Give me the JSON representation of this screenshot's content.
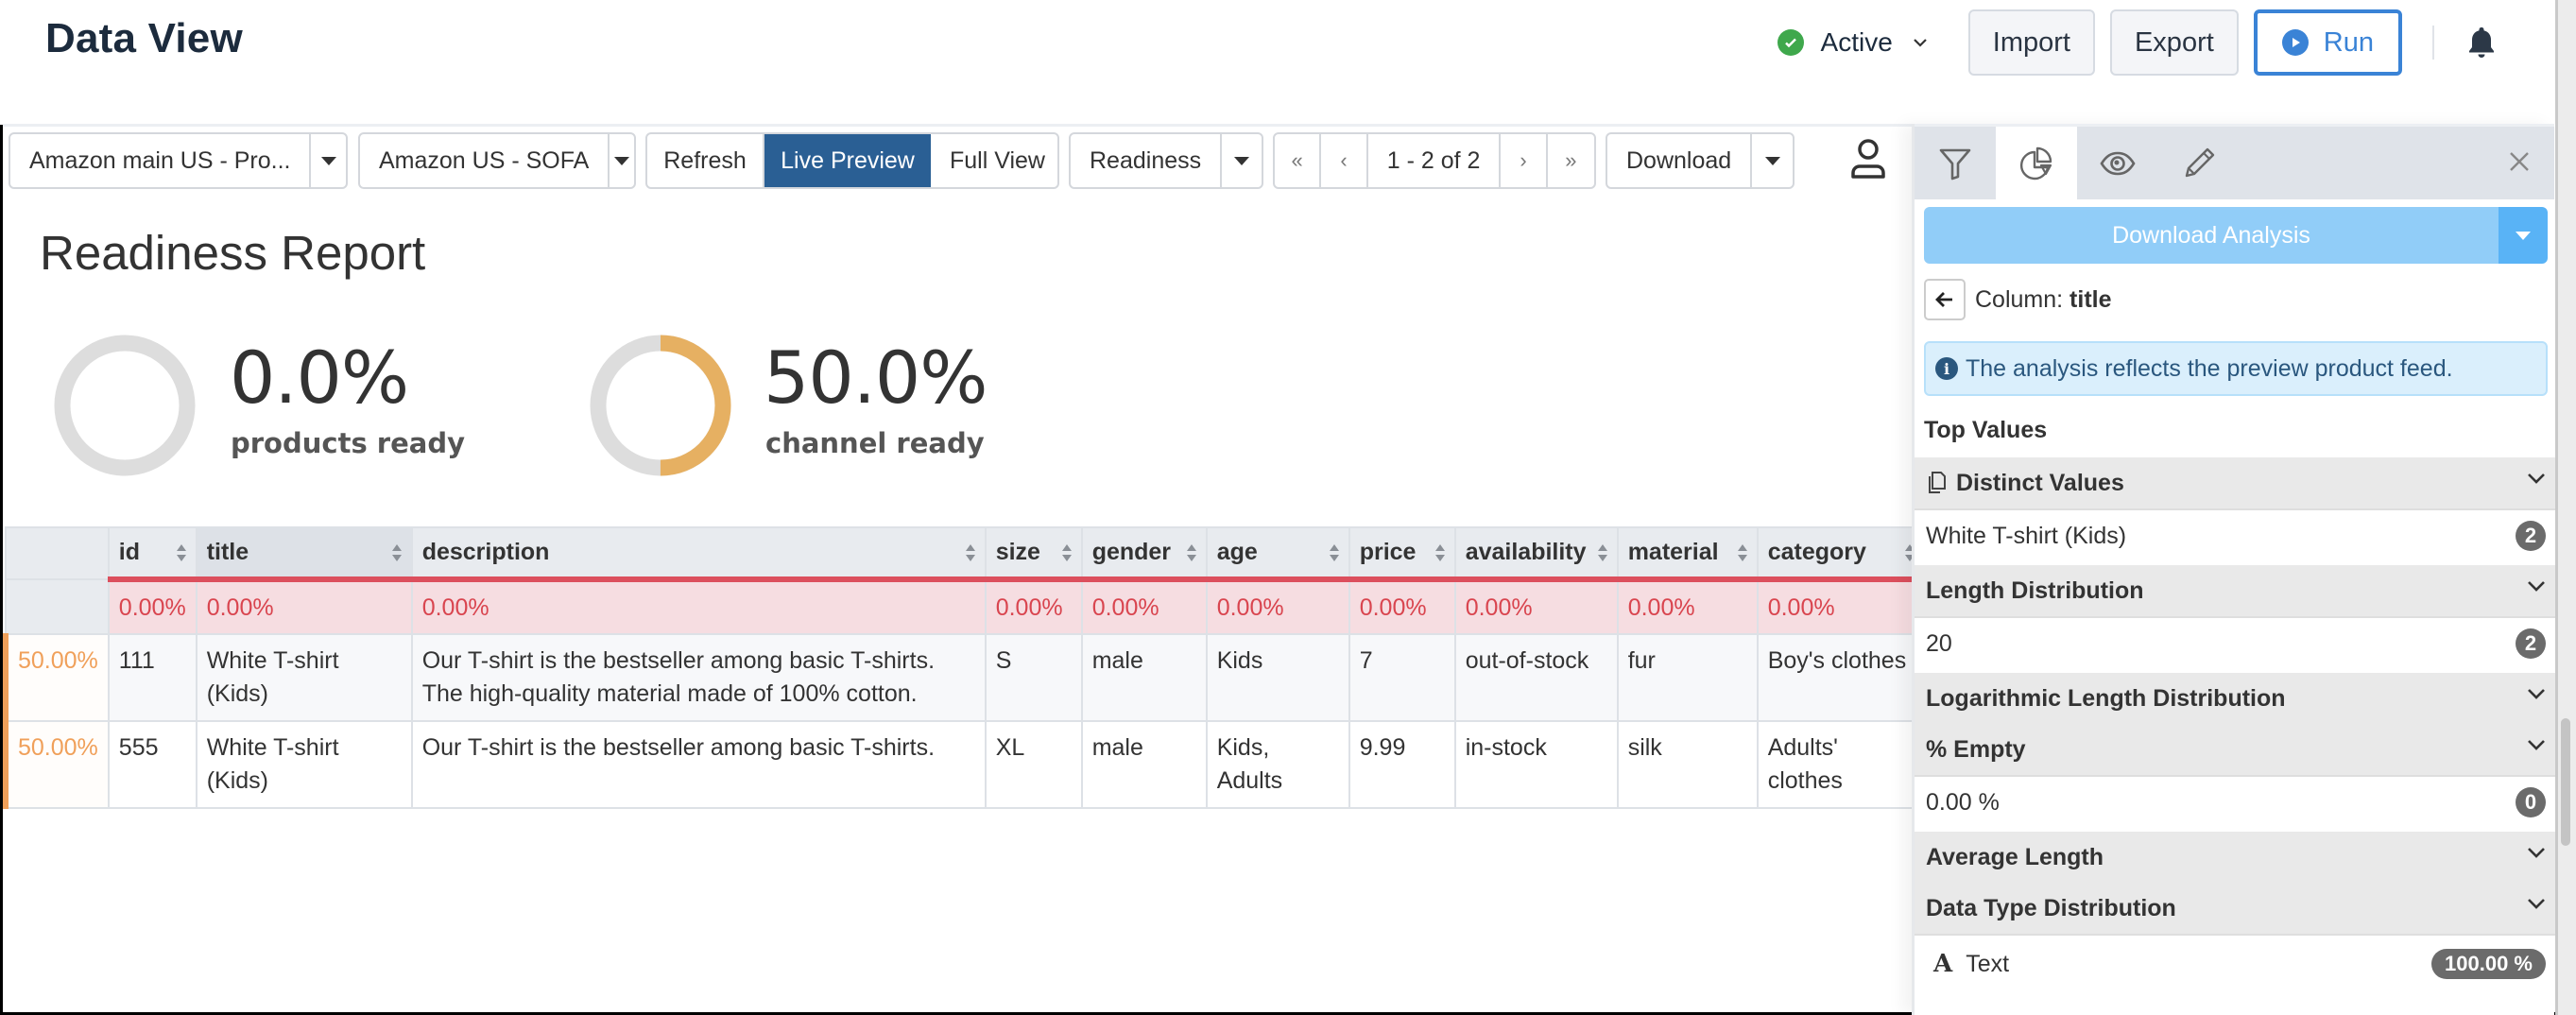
{
  "header": {
    "title": "Data View",
    "status": "Active",
    "buttons": {
      "import": "Import",
      "export": "Export",
      "run": "Run"
    },
    "colors": {
      "status_green": "#3fa84c",
      "run_blue": "#3a83d6"
    }
  },
  "toolbar": {
    "feed_select": "Amazon main US - Pro...",
    "channel_select": "Amazon US - SOFA",
    "refresh": "Refresh",
    "live_preview": "Live Preview",
    "full_view": "Full View",
    "readiness": "Readiness",
    "pager": {
      "first": "«",
      "prev": "‹",
      "label": "1 - 2 of 2",
      "next": "›",
      "last": "»"
    },
    "download": "Download",
    "active_color": "#2a5f94"
  },
  "readiness": {
    "title": "Readiness Report",
    "products": {
      "value": 0.0,
      "pct_label": "0.0%",
      "label": "products ready"
    },
    "channel": {
      "value": 50.0,
      "pct_label": "50.0%",
      "label": "channel ready"
    },
    "colors": {
      "track": "#dddddd",
      "fill": "#e6b062"
    }
  },
  "table": {
    "columns": [
      "id",
      "title",
      "description",
      "size",
      "gender",
      "age",
      "price",
      "availability",
      "material",
      "category"
    ],
    "selected_column": "title",
    "error_row": [
      "0.00%",
      "0.00%",
      "0.00%",
      "0.00%",
      "0.00%",
      "0.00%",
      "0.00%",
      "0.00%",
      "0.00%",
      "0.00%"
    ],
    "rows": [
      {
        "readiness": "50.00%",
        "cells": [
          "111",
          "White T-shirt (Kids)",
          "Our T-shirt is the bestseller among basic T-shirts. The high-quality material made of 100% cotton.",
          "S",
          "male",
          "Kids",
          "7",
          "out-of-stock",
          "fur",
          "Boy's clothes"
        ]
      },
      {
        "readiness": "50.00%",
        "cells": [
          "555",
          "White T-shirt (Kids)",
          "Our T-shirt is the bestseller among basic T-shirts.",
          "XL",
          "male",
          "Kids, Adults",
          "9.99",
          "in-stock",
          "silk",
          "Adults' clothes"
        ]
      }
    ]
  },
  "panel": {
    "tabs": [
      "filter-icon",
      "pie-chart-icon",
      "eye-icon",
      "pencil-icon"
    ],
    "active_tab": "pie-chart-icon",
    "download_analysis": "Download Analysis",
    "column_prefix": "Column:",
    "column_name": "title",
    "info": "The analysis reflects the preview product feed.",
    "top_values": "Top Values",
    "sections": {
      "distinct": {
        "title": "Distinct Values",
        "value": "White T-shirt (Kids)",
        "count": "2"
      },
      "length": {
        "title": "Length Distribution",
        "value": "20",
        "count": "2"
      },
      "log_length": {
        "title": "Logarithmic Length Distribution"
      },
      "empty": {
        "title": "% Empty",
        "value": "0.00 %",
        "count": "0"
      },
      "avg_length": {
        "title": "Average Length"
      },
      "data_type": {
        "title": "Data Type Distribution",
        "value": "Text",
        "count": "100.00 %"
      }
    }
  }
}
